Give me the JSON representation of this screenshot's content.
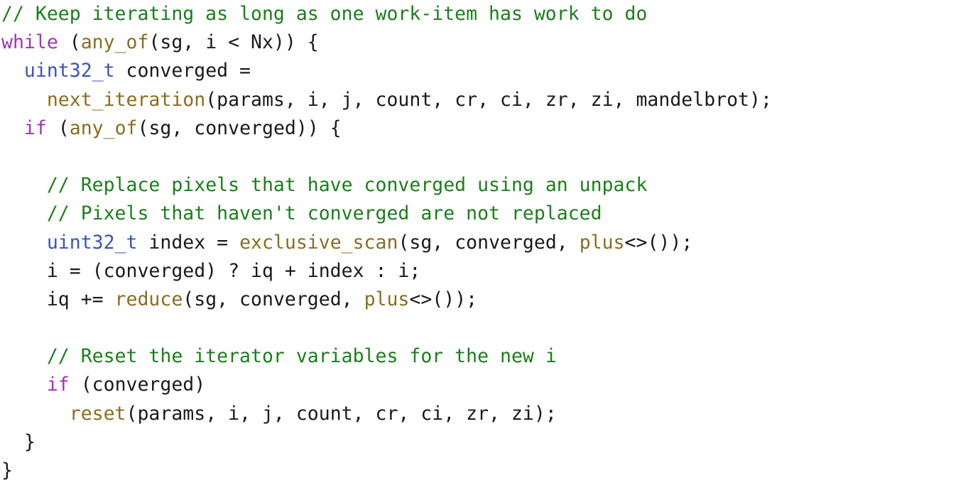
{
  "document": {
    "kind": "source-code-listing",
    "language": "C++",
    "background_color": "#ffffff",
    "default_text_color": "#1a1a1a"
  },
  "syntax_colors": {
    "comment": "#1a7f1a",
    "keyword": "#a533b8",
    "type": "#3a53c0",
    "function": "#8a6d1f",
    "plain": "#1a1a1a"
  },
  "code": {
    "full_text": "// Keep iterating as long as one work-item has work to do\nwhile (any_of(sg, i < Nx)) {\n  uint32_t converged =\n    next_iteration(params, i, j, count, cr, ci, zr, zi, mandelbrot);\n  if (any_of(sg, converged)) {\n\n    // Replace pixels that have converged using an unpack\n    // Pixels that haven't converged are not replaced\n    uint32_t index = exclusive_scan(sg, converged, plus<>());\n    i = (converged) ? iq + index : i;\n    iq += reduce(sg, converged, plus<>());\n\n    // Reset the iterator variables for the new i\n    if (converged)\n      reset(params, i, j, count, cr, ci, zr, zi);\n  }\n}",
    "lines": [
      {
        "index": 1,
        "tokens": [
          {
            "text": "// Keep iterating as long as one work-item has work to do",
            "kind": "comment"
          }
        ]
      },
      {
        "index": 2,
        "tokens": [
          {
            "text": "while",
            "kind": "keyword"
          },
          {
            "text": " (",
            "kind": "plain"
          },
          {
            "text": "any_of",
            "kind": "func"
          },
          {
            "text": "(sg, i < Nx)) {",
            "kind": "plain"
          }
        ]
      },
      {
        "index": 3,
        "tokens": [
          {
            "text": "  ",
            "kind": "plain"
          },
          {
            "text": "uint32_t",
            "kind": "type"
          },
          {
            "text": " converged =",
            "kind": "plain"
          }
        ]
      },
      {
        "index": 4,
        "tokens": [
          {
            "text": "    ",
            "kind": "plain"
          },
          {
            "text": "next_iteration",
            "kind": "func"
          },
          {
            "text": "(params, i, j, count, cr, ci, zr, zi, mandelbrot);",
            "kind": "plain"
          }
        ]
      },
      {
        "index": 5,
        "tokens": [
          {
            "text": "  ",
            "kind": "plain"
          },
          {
            "text": "if",
            "kind": "keyword"
          },
          {
            "text": " (",
            "kind": "plain"
          },
          {
            "text": "any_of",
            "kind": "func"
          },
          {
            "text": "(sg, converged)) {",
            "kind": "plain"
          }
        ]
      },
      {
        "index": 6,
        "tokens": []
      },
      {
        "index": 7,
        "tokens": [
          {
            "text": "    ",
            "kind": "plain"
          },
          {
            "text": "// Replace pixels that have converged using an unpack",
            "kind": "comment"
          }
        ]
      },
      {
        "index": 8,
        "tokens": [
          {
            "text": "    ",
            "kind": "plain"
          },
          {
            "text": "// Pixels that haven't converged are not replaced",
            "kind": "comment"
          }
        ]
      },
      {
        "index": 9,
        "tokens": [
          {
            "text": "    ",
            "kind": "plain"
          },
          {
            "text": "uint32_t",
            "kind": "type"
          },
          {
            "text": " index = ",
            "kind": "plain"
          },
          {
            "text": "exclusive_scan",
            "kind": "func"
          },
          {
            "text": "(sg, converged, ",
            "kind": "plain"
          },
          {
            "text": "plus",
            "kind": "func"
          },
          {
            "text": "<>());",
            "kind": "plain"
          }
        ]
      },
      {
        "index": 10,
        "tokens": [
          {
            "text": "    i = (converged) ? iq + index : i;",
            "kind": "plain"
          }
        ]
      },
      {
        "index": 11,
        "tokens": [
          {
            "text": "    iq += ",
            "kind": "plain"
          },
          {
            "text": "reduce",
            "kind": "func"
          },
          {
            "text": "(sg, converged, ",
            "kind": "plain"
          },
          {
            "text": "plus",
            "kind": "func"
          },
          {
            "text": "<>());",
            "kind": "plain"
          }
        ]
      },
      {
        "index": 12,
        "tokens": []
      },
      {
        "index": 13,
        "tokens": [
          {
            "text": "    ",
            "kind": "plain"
          },
          {
            "text": "// Reset the iterator variables for the new i",
            "kind": "comment"
          }
        ]
      },
      {
        "index": 14,
        "tokens": [
          {
            "text": "    ",
            "kind": "plain"
          },
          {
            "text": "if",
            "kind": "keyword"
          },
          {
            "text": " (converged)",
            "kind": "plain"
          }
        ]
      },
      {
        "index": 15,
        "tokens": [
          {
            "text": "      ",
            "kind": "plain"
          },
          {
            "text": "reset",
            "kind": "func"
          },
          {
            "text": "(params, i, j, count, cr, ci, zr, zi);",
            "kind": "plain"
          }
        ]
      },
      {
        "index": 16,
        "tokens": [
          {
            "text": "  }",
            "kind": "plain"
          }
        ]
      },
      {
        "index": 17,
        "tokens": [
          {
            "text": "}",
            "kind": "plain"
          }
        ]
      }
    ]
  }
}
